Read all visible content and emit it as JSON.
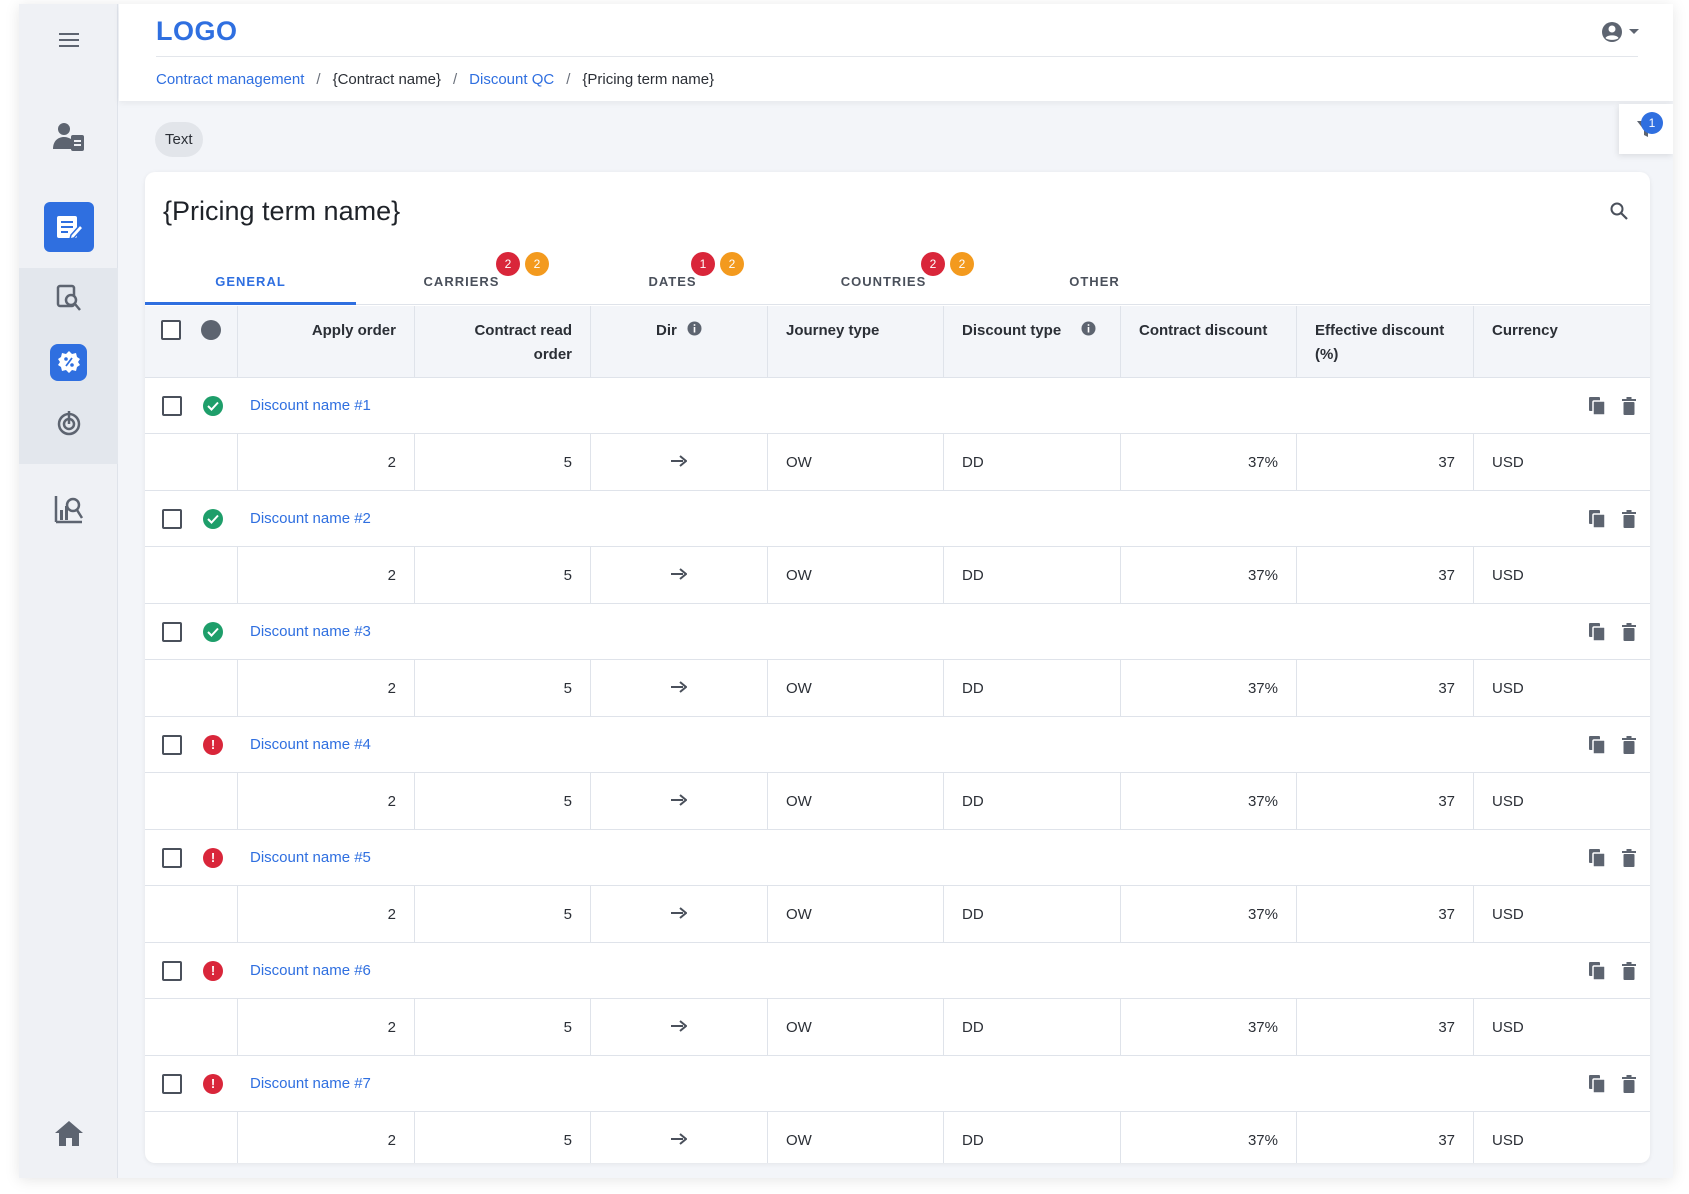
{
  "header": {
    "logo": "LOGO",
    "breadcrumb": [
      {
        "label": "Contract management",
        "link": true
      },
      {
        "label": "{Contract name}",
        "link": false
      },
      {
        "label": "Discount QC",
        "link": true
      },
      {
        "label": "{Pricing term name}",
        "link": false
      }
    ],
    "separator": "/"
  },
  "sidebar": {
    "items": [
      {
        "icon": "menu-icon"
      },
      {
        "icon": "user-clipboard-icon"
      },
      {
        "icon": "document-edit-icon",
        "active": true
      },
      {
        "icon": "search-document-icon"
      },
      {
        "icon": "discount-badge-icon",
        "active": true
      },
      {
        "icon": "target-icon"
      },
      {
        "icon": "chart-search-icon"
      },
      {
        "icon": "home-icon"
      }
    ]
  },
  "filter": {
    "badge": "1"
  },
  "chip": {
    "label": "Text"
  },
  "card": {
    "title": "{Pricing term name}"
  },
  "tabs": [
    {
      "label": "GENERAL",
      "active": true,
      "badges": []
    },
    {
      "label": "CARRIERS",
      "badges": [
        {
          "value": "2",
          "color": "#d9263a"
        },
        {
          "value": "2",
          "color": "#f39a1e"
        }
      ]
    },
    {
      "label": "DATES",
      "badges": [
        {
          "value": "1",
          "color": "#d9263a"
        },
        {
          "value": "2",
          "color": "#f39a1e"
        }
      ]
    },
    {
      "label": "COUNTRIES",
      "badges": [
        {
          "value": "2",
          "color": "#d9263a"
        },
        {
          "value": "2",
          "color": "#f39a1e"
        }
      ]
    },
    {
      "label": "OTHER",
      "badges": []
    }
  ],
  "table": {
    "columns": {
      "apply_order": "Apply order",
      "contract_read_order": "Contract read order",
      "dir": "Dir",
      "journey_type": "Journey type",
      "discount_type": "Discount type",
      "contract_discount": "Contract discount",
      "effective_discount": "Effective discount (%)",
      "currency": "Currency"
    },
    "rows": [
      {
        "name": "Discount name #1",
        "status": "ok",
        "apply_order": "2",
        "read_order": "5",
        "dir": "→",
        "journey": "OW",
        "dtype": "DD",
        "contract_discount": "37%",
        "effective_discount": "37",
        "currency": "USD"
      },
      {
        "name": "Discount name #2",
        "status": "ok",
        "apply_order": "2",
        "read_order": "5",
        "dir": "→",
        "journey": "OW",
        "dtype": "DD",
        "contract_discount": "37%",
        "effective_discount": "37",
        "currency": "USD"
      },
      {
        "name": "Discount name #3",
        "status": "ok",
        "apply_order": "2",
        "read_order": "5",
        "dir": "→",
        "journey": "OW",
        "dtype": "DD",
        "contract_discount": "37%",
        "effective_discount": "37",
        "currency": "USD"
      },
      {
        "name": "Discount name #4",
        "status": "error",
        "apply_order": "2",
        "read_order": "5",
        "dir": "→",
        "journey": "OW",
        "dtype": "DD",
        "contract_discount": "37%",
        "effective_discount": "37",
        "currency": "USD"
      },
      {
        "name": "Discount name #5",
        "status": "error",
        "apply_order": "2",
        "read_order": "5",
        "dir": "→",
        "journey": "OW",
        "dtype": "DD",
        "contract_discount": "37%",
        "effective_discount": "37",
        "currency": "USD"
      },
      {
        "name": "Discount name #6",
        "status": "error",
        "apply_order": "2",
        "read_order": "5",
        "dir": "→",
        "journey": "OW",
        "dtype": "DD",
        "contract_discount": "37%",
        "effective_discount": "37",
        "currency": "USD"
      },
      {
        "name": "Discount name #7",
        "status": "error",
        "apply_order": "2",
        "read_order": "5",
        "dir": "→",
        "journey": "OW",
        "dtype": "DD",
        "contract_discount": "37%",
        "effective_discount": "37",
        "currency": "USD"
      }
    ]
  },
  "colors": {
    "accent": "#2f6fe0",
    "success": "#1e9e6a",
    "error": "#d9263a",
    "warning": "#f39a1e"
  }
}
